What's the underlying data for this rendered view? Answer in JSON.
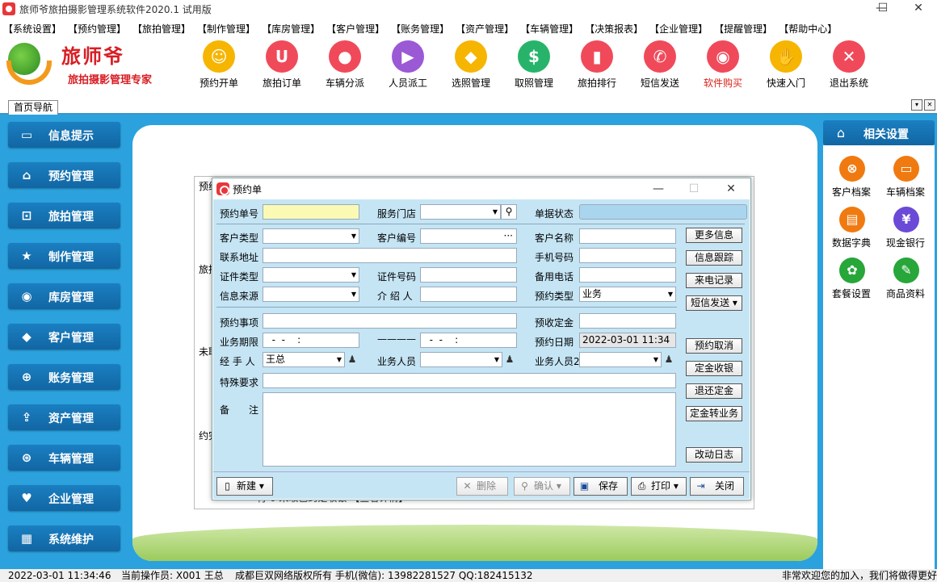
{
  "window": {
    "title": "旅师爷旅拍摄影管理系统软件2020.1 试用版",
    "min": "—",
    "max": "☐",
    "close": "✕"
  },
  "menu": [
    "【系统设置】",
    "【预约管理】",
    "【旅拍管理】",
    "【制作管理】",
    "【库房管理】",
    "【客户管理】",
    "【账务管理】",
    "【资产管理】",
    "【车辆管理】",
    "【决策报表】",
    "【企业管理】",
    "【提醒管理】",
    "【帮助中心】"
  ],
  "logo": {
    "name": "旅师爷",
    "slogan": "旅拍摄影管理专家"
  },
  "toolbar": [
    {
      "label": "预约开单",
      "color": "#f6b500",
      "glyph": "☺"
    },
    {
      "label": "旅拍订单",
      "color": "#f04a5a",
      "glyph": "U"
    },
    {
      "label": "车辆分派",
      "color": "#f04a5a",
      "glyph": "●"
    },
    {
      "label": "人员派工",
      "color": "#9b59d6",
      "glyph": "▶"
    },
    {
      "label": "选照管理",
      "color": "#f6b500",
      "glyph": "◆"
    },
    {
      "label": "取照管理",
      "color": "#27b46a",
      "glyph": "$"
    },
    {
      "label": "旅拍排行",
      "color": "#f04a5a",
      "glyph": "▮"
    },
    {
      "label": "短信发送",
      "color": "#f04a5a",
      "glyph": "✆"
    },
    {
      "label": "软件购买",
      "color": "#f04a5a",
      "glyph": "◉",
      "highlight": "#d8241a"
    },
    {
      "label": "快速入门",
      "color": "#f6b500",
      "glyph": "✋"
    },
    {
      "label": "退出系统",
      "color": "#f04a5a",
      "glyph": "✕"
    }
  ],
  "tabs": {
    "home": "首页导航",
    "arrow_down": "▾",
    "close": "✕"
  },
  "leftnav": [
    {
      "label": "信息提示",
      "glyph": "▭"
    },
    {
      "label": "预约管理",
      "glyph": "⌂"
    },
    {
      "label": "旅拍管理",
      "glyph": "⊡"
    },
    {
      "label": "制作管理",
      "glyph": "★"
    },
    {
      "label": "库房管理",
      "glyph": "◉"
    },
    {
      "label": "客户管理",
      "glyph": "◆"
    },
    {
      "label": "账务管理",
      "glyph": "⊕"
    },
    {
      "label": "资产管理",
      "glyph": "⇪"
    },
    {
      "label": "车辆管理",
      "glyph": "⊛"
    },
    {
      "label": "企业管理",
      "glyph": "♥"
    },
    {
      "label": "系统维护",
      "glyph": "▦"
    }
  ],
  "rightpanel": {
    "title": "相关设置",
    "home_glyph": "⌂",
    "items": [
      {
        "label": "客户档案",
        "color": "#f07a10",
        "glyph": "⊗"
      },
      {
        "label": "车辆档案",
        "color": "#f07a10",
        "glyph": "▭"
      },
      {
        "label": "数据字典",
        "color": "#f07a10",
        "glyph": "▤"
      },
      {
        "label": "现金银行",
        "color": "#6a4ad6",
        "glyph": "¥"
      },
      {
        "label": "套餐设置",
        "color": "#27a63a",
        "glyph": "✿"
      },
      {
        "label": "商品资料",
        "color": "#27a63a",
        "glyph": "✎"
      }
    ]
  },
  "background": {
    "tabs": [
      "预约",
      "旅拍",
      "未取",
      "约完"
    ],
    "row_text": "- 行    0     未取已约定收银     【查看详情】"
  },
  "dialog": {
    "title": "预约单",
    "min": "—",
    "max": "☐",
    "close": "✕",
    "labels": {
      "order_no": "预约单号",
      "store": "服务门店",
      "status": "单据状态",
      "cust_type": "客户类型",
      "cust_no": "客户编号",
      "cust_name": "客户名称",
      "address": "联系地址",
      "mobile": "手机号码",
      "id_type": "证件类型",
      "id_no": "证件号码",
      "backup_phone": "备用电话",
      "source": "信息来源",
      "referrer": "介 绍 人",
      "appt_type": "预约类型",
      "appt_item": "预约事项",
      "deposit": "预收定金",
      "period": "业务期限",
      "appt_date": "预约日期",
      "handler": "经 手 人",
      "staff": "业务人员",
      "staff2": "业务人员2",
      "special": "特殊要求",
      "remark": "备　　注"
    },
    "values": {
      "appt_type": "业务",
      "period_from": "  -  -    :",
      "period_to": "  -  -    :",
      "appt_date": "2022-03-01 11:34",
      "handler": "王总",
      "cust_no_btn": "···",
      "period_dash": "————"
    },
    "side_buttons": [
      "更多信息",
      "信息跟踪",
      "来电记录",
      "短信发送 ▾",
      "预约取消",
      "定金收银",
      "退还定金",
      "定金转业务",
      "改动日志"
    ],
    "bottom": {
      "new": "新建 ▾",
      "delete": "删除",
      "confirm": "确认 ▾",
      "save": "保存",
      "print": "打印 ▾",
      "close": "关闭"
    }
  },
  "statusbar": {
    "datetime": "2022-03-01 11:34:46",
    "operator": "当前操作员: X001 王总",
    "copyright": "成都巨双网络版权所有 手机(微信): 13982281527 QQ:182415132",
    "welcome": "非常欢迎您的加入，我们将做得更好"
  }
}
